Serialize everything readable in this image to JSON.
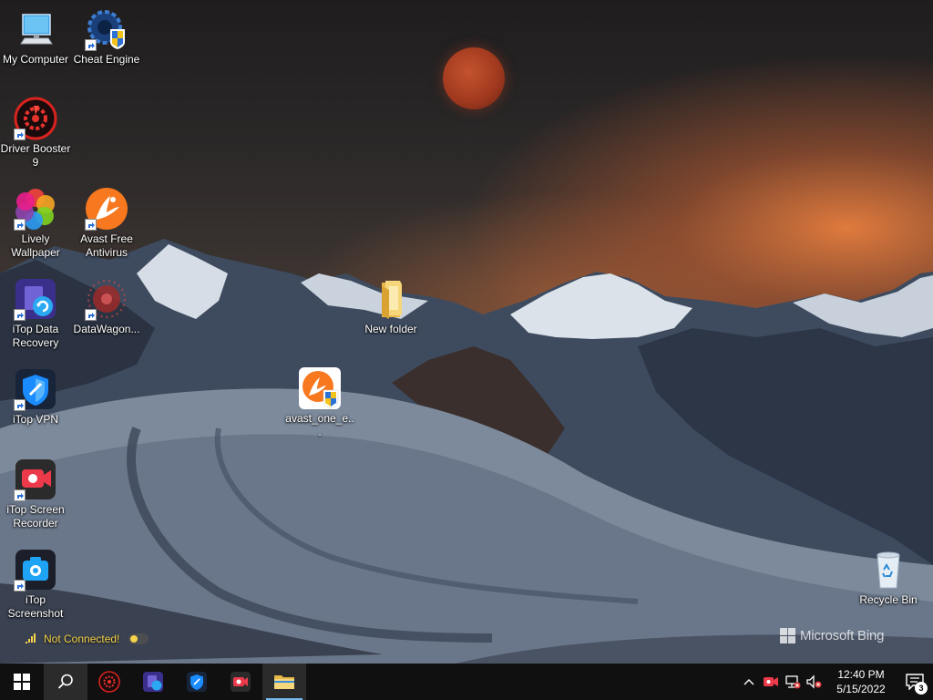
{
  "desktop": {
    "icons": [
      {
        "label": "My Computer",
        "icon": "computer-icon"
      },
      {
        "label": "Cheat Engine",
        "icon": "cheat-engine-icon"
      },
      {
        "label": "Driver Booster 9",
        "icon": "driver-booster-icon"
      },
      {
        "label": "Lively Wallpaper",
        "icon": "lively-wallpaper-icon"
      },
      {
        "label": "Avast Free Antivirus",
        "icon": "avast-icon"
      },
      {
        "label": "iTop Data Recovery",
        "icon": "itop-data-recovery-icon"
      },
      {
        "label": "DataWagon...",
        "icon": "datawagon-icon"
      },
      {
        "label": "New folder",
        "icon": "folder-icon"
      },
      {
        "label": "avast_one_e...",
        "icon": "avast-installer-icon"
      },
      {
        "label": "iTop VPN",
        "icon": "itop-vpn-icon"
      },
      {
        "label": "iTop Screen Recorder",
        "icon": "itop-screen-recorder-icon"
      },
      {
        "label": "iTop Screenshot",
        "icon": "itop-screenshot-icon"
      },
      {
        "label": "Recycle Bin",
        "icon": "recycle-bin-icon"
      }
    ],
    "widget": {
      "status": "Not Connected!"
    },
    "watermark": "Microsoft Bing"
  },
  "taskbar": {
    "buttons": [
      {
        "name": "start-button",
        "icon": "windows-logo-icon"
      },
      {
        "name": "search-button",
        "icon": "search-icon"
      },
      {
        "name": "driver-booster-taskbar",
        "icon": "driver-booster-icon"
      },
      {
        "name": "itop-data-recovery-taskbar",
        "icon": "itop-data-recovery-icon"
      },
      {
        "name": "itop-vpn-taskbar",
        "icon": "itop-vpn-icon"
      },
      {
        "name": "itop-screen-recorder-taskbar",
        "icon": "itop-screen-recorder-icon"
      },
      {
        "name": "file-explorer-taskbar",
        "icon": "folder-icon"
      }
    ],
    "tray": {
      "time": "12:40 PM",
      "date": "5/15/2022",
      "notification_count": "3"
    }
  }
}
